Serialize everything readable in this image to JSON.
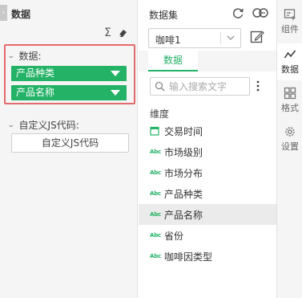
{
  "left_panel": {
    "title": "数据",
    "sigma_symbol": "Σ",
    "data_section": {
      "label": "数据:",
      "fields": [
        "产品种类",
        "产品名称"
      ]
    },
    "custom_js_section": {
      "label": "自定义JS代码:",
      "button_label": "自定义JS代码"
    }
  },
  "middle_panel": {
    "title": "数据集",
    "dataset_select": {
      "value": "咖啡1"
    },
    "tab_label": "数据",
    "search": {
      "placeholder": "输入搜索文字"
    },
    "dimension_label": "维度",
    "abc_label": "Abc",
    "fields": [
      {
        "label": "交易时间",
        "icon": "calendar-icon"
      },
      {
        "label": "市场级别",
        "icon": "abc-icon"
      },
      {
        "label": "市场分布",
        "icon": "abc-icon"
      },
      {
        "label": "产品种类",
        "icon": "abc-icon"
      },
      {
        "label": "产品名称",
        "icon": "abc-icon",
        "selected": true
      },
      {
        "label": "省份",
        "icon": "abc-icon"
      },
      {
        "label": "咖啡因类型",
        "icon": "abc-icon"
      }
    ]
  },
  "right_tabs": [
    {
      "label": "组件",
      "icon": "component-icon"
    },
    {
      "label": "数据",
      "icon": "data-chart-icon",
      "active": true
    },
    {
      "label": "格式",
      "icon": "grid-format-icon"
    },
    {
      "label": "设置",
      "icon": "settings-icon"
    }
  ],
  "colors": {
    "accent": "#23b266",
    "highlight_border": "#e36b6b",
    "panel_bg": "#f5f5f5"
  }
}
